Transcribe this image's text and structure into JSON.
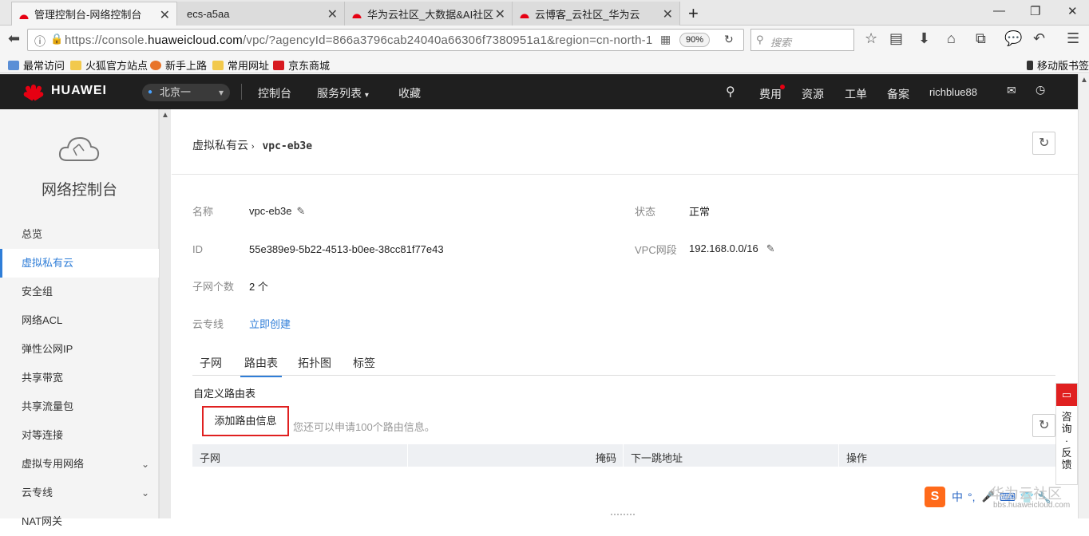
{
  "browser": {
    "tabs": [
      {
        "title": "管理控制台-网络控制台",
        "active": true
      },
      {
        "title": "ecs-a5aa",
        "active": false
      },
      {
        "title": "华为云社区_大数据&AI社区",
        "active": false
      },
      {
        "title": "云博客_云社区_华为云",
        "active": false
      }
    ],
    "url_prefix": "https://console.",
    "url_domain": "huaweicloud.com",
    "url_rest": "/vpc/?agencyId=866a3796cab24040a66306f7380951a1&region=cn-north-1",
    "zoom": "90%",
    "search_placeholder": "搜索",
    "bookmarks": [
      "最常访问",
      "火狐官方站点",
      "新手上路",
      "常用网址",
      "京东商城"
    ],
    "mobile_bookmarks": "移动版书签"
  },
  "header": {
    "logo": "HUAWEI",
    "region": "北京一",
    "nav": [
      "控制台",
      "服务列表",
      "收藏"
    ],
    "right": [
      "费用",
      "资源",
      "工单",
      "备案"
    ],
    "username": "richblue88"
  },
  "sidebar": {
    "title": "网络控制台",
    "items": [
      {
        "label": "总览",
        "active": false
      },
      {
        "label": "虚拟私有云",
        "active": true
      },
      {
        "label": "安全组",
        "active": false
      },
      {
        "label": "网络ACL",
        "active": false
      },
      {
        "label": "弹性公网IP",
        "active": false
      },
      {
        "label": "共享带宽",
        "active": false
      },
      {
        "label": "共享流量包",
        "active": false
      },
      {
        "label": "对等连接",
        "active": false
      },
      {
        "label": "虚拟专用网络",
        "active": false,
        "expandable": true
      },
      {
        "label": "云专线",
        "active": false,
        "expandable": true
      },
      {
        "label": "NAT网关",
        "active": false
      }
    ]
  },
  "breadcrumb": {
    "parent": "虚拟私有云",
    "current": "vpc-eb3e"
  },
  "details": {
    "name_label": "名称",
    "name_value": "vpc-eb3e",
    "status_label": "状态",
    "status_value": "正常",
    "id_label": "ID",
    "id_value": "55e389e9-5b22-4513-b0ee-38cc81f77e43",
    "cidr_label": "VPC网段",
    "cidr_value": "192.168.0.0/16",
    "subnets_label": "子网个数",
    "subnets_value": "2 个",
    "dc_label": "云专线",
    "dc_value": "立即创建"
  },
  "content_tabs": [
    {
      "label": "子网",
      "active": false
    },
    {
      "label": "路由表",
      "active": true
    },
    {
      "label": "拓扑图",
      "active": false
    },
    {
      "label": "标签",
      "active": false
    }
  ],
  "route_table": {
    "section_title": "自定义路由表",
    "add_button": "添加路由信息",
    "hint": "您还可以申请100个路由信息。",
    "columns": [
      "子网",
      "掩码",
      "下一跳地址",
      "操作"
    ]
  },
  "feedback": {
    "label": "咨询·反馈"
  },
  "watermark": {
    "text": "华为云社区",
    "domain": "bbs.huaweicloud.com"
  },
  "ime": {
    "text": "中",
    "extra": "°,"
  }
}
